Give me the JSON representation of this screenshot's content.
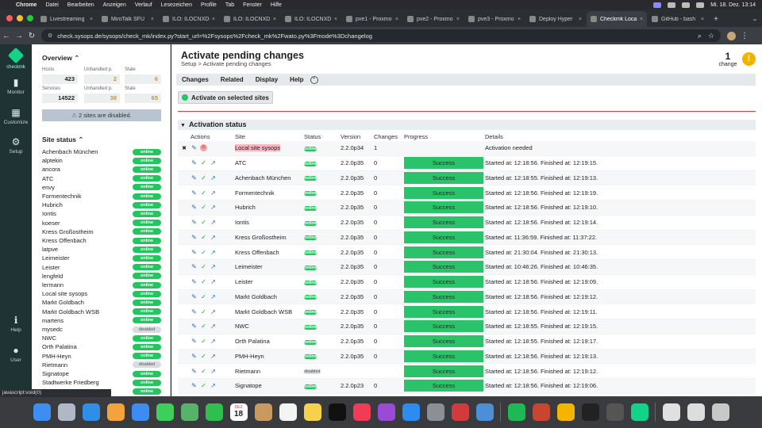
{
  "menubar": {
    "items": [
      "Chrome",
      "Datei",
      "Bearbeiten",
      "Anzeigen",
      "Verlauf",
      "Lesezeichen",
      "Profile",
      "Tab",
      "Fenster",
      "Hilfe"
    ],
    "clock": "Mi. 18. Dez. 13:14"
  },
  "browser": {
    "tabs": [
      {
        "label": "Livestreaming",
        "active": false
      },
      {
        "label": "MiroTalk SFU",
        "active": false
      },
      {
        "label": "ILO: ILOCNXDI",
        "active": false
      },
      {
        "label": "ILO: ILOCNXD",
        "active": false
      },
      {
        "label": "ILO: ILOCNXD",
        "active": false
      },
      {
        "label": "pve1 - Proxmo",
        "active": false
      },
      {
        "label": "pve2 - Proxmo",
        "active": false
      },
      {
        "label": "pve3 - Proxmo",
        "active": false
      },
      {
        "label": "Deploy Hyper",
        "active": false
      },
      {
        "label": "Checkmk Loca",
        "active": true
      },
      {
        "label": "GitHub - bash",
        "active": false
      }
    ],
    "url": "check.sysops.de/sysops/check_mk/index.py?start_url=%2Fsysops%2Fcheck_mk%2Fwato.py%3Fmode%3Dchangelog",
    "statusbar": "javascript:void(0)"
  },
  "nav": {
    "brand": "checkmk",
    "items": [
      {
        "label": "Monitor",
        "icon": "bar-chart-icon"
      },
      {
        "label": "Customize",
        "icon": "grid-icon"
      },
      {
        "label": "Setup",
        "icon": "gear-icon"
      },
      {
        "label": "Help",
        "icon": "help-icon"
      },
      {
        "label": "User",
        "icon": "user-icon"
      }
    ]
  },
  "sidebar": {
    "overview_title": "Overview",
    "overview": {
      "hosts_label": "Hosts",
      "hosts": "423",
      "hosts_unhandled_label": "Unhandled p.",
      "hosts_unhandled": "2",
      "hosts_stale_label": "Stale",
      "hosts_stale": "6",
      "services_label": "Services",
      "services": "14522",
      "services_unhandled_label": "Unhandled p.",
      "services_unhandled": "38",
      "services_stale_label": "Stale",
      "services_stale": "65"
    },
    "disabled_notice": "2 sites are disabled.",
    "site_status_title": "Site status",
    "sites": [
      {
        "name": "Achenbach München",
        "status": "online"
      },
      {
        "name": "alptekin",
        "status": "online"
      },
      {
        "name": "ancora",
        "status": "online"
      },
      {
        "name": "ATC",
        "status": "online"
      },
      {
        "name": "envy",
        "status": "online"
      },
      {
        "name": "Formentechnik",
        "status": "online"
      },
      {
        "name": "Hubrich",
        "status": "online"
      },
      {
        "name": "Iontis",
        "status": "online"
      },
      {
        "name": "koeser",
        "status": "online"
      },
      {
        "name": "Kress Großostheim",
        "status": "online"
      },
      {
        "name": "Kress Offenbach",
        "status": "online"
      },
      {
        "name": "latpve",
        "status": "online"
      },
      {
        "name": "Leimeister",
        "status": "online"
      },
      {
        "name": "Leister",
        "status": "online"
      },
      {
        "name": "lengfeld",
        "status": "online"
      },
      {
        "name": "lermann",
        "status": "online"
      },
      {
        "name": "Local site sysops",
        "status": "online"
      },
      {
        "name": "Markt Goldbach",
        "status": "online"
      },
      {
        "name": "Markt Goldbach WSB",
        "status": "online"
      },
      {
        "name": "martens",
        "status": "online"
      },
      {
        "name": "mysedc",
        "status": "disabled"
      },
      {
        "name": "NWC",
        "status": "online"
      },
      {
        "name": "Orth Palatina",
        "status": "online"
      },
      {
        "name": "PMH-Heyn",
        "status": "online"
      },
      {
        "name": "Rietmann",
        "status": "disabled"
      },
      {
        "name": "Signatope",
        "status": "online"
      },
      {
        "name": "Stadtwerke Friedberg",
        "status": "online"
      },
      {
        "name": "thermsys",
        "status": "online"
      }
    ]
  },
  "page": {
    "title": "Activate pending changes",
    "breadcrumb": "Setup > Activate pending changes",
    "change_count": "1",
    "change_label": "change",
    "menu": [
      "Changes",
      "Related",
      "Display",
      "Help"
    ],
    "activate_button": "Activate on selected sites",
    "section_title": "Activation status",
    "columns": [
      "Actions",
      "Site",
      "Status",
      "Version",
      "Changes",
      "Progress",
      "Details"
    ],
    "rows": [
      {
        "site": "Local site sysops",
        "status": "online",
        "version": "2.2.0p34",
        "changes": "1",
        "progress": "",
        "details": "Activation needed",
        "pending": true
      },
      {
        "site": "ATC",
        "status": "online",
        "version": "2.2.0p35",
        "changes": "0",
        "progress": "Success",
        "details": "Started at: 12:18:56. Finished at: 12:19:15."
      },
      {
        "site": "Achenbach München",
        "status": "online",
        "version": "2.2.0p35",
        "changes": "0",
        "progress": "Success",
        "details": "Started at: 12:18:55. Finished at: 12:19:13."
      },
      {
        "site": "Formentechnik",
        "status": "online",
        "version": "2.2.0p35",
        "changes": "0",
        "progress": "Success",
        "details": "Started at: 12:18:56. Finished at: 12:19:19."
      },
      {
        "site": "Hubrich",
        "status": "online",
        "version": "2.2.0p35",
        "changes": "0",
        "progress": "Success",
        "details": "Started at: 12:18:56. Finished at: 12:19:10."
      },
      {
        "site": "Iontis",
        "status": "online",
        "version": "2.2.0p35",
        "changes": "0",
        "progress": "Success",
        "details": "Started at: 12:18:56. Finished at: 12:19:14."
      },
      {
        "site": "Kress Großostheim",
        "status": "online",
        "version": "2.2.0p35",
        "changes": "0",
        "progress": "Success",
        "details": "Started at: 11:36:59. Finished at: 11:37:22."
      },
      {
        "site": "Kress Offenbach",
        "status": "online",
        "version": "2.2.0p35",
        "changes": "0",
        "progress": "Success",
        "details": "Started at: 21:30:04. Finished at: 21:30:13."
      },
      {
        "site": "Leimeister",
        "status": "online",
        "version": "2.2.0p35",
        "changes": "0",
        "progress": "Success",
        "details": "Started at: 10:46:26. Finished at: 10:46:35."
      },
      {
        "site": "Leister",
        "status": "online",
        "version": "2.2.0p35",
        "changes": "0",
        "progress": "Success",
        "details": "Started at: 12:18:56. Finished at: 12:19:09."
      },
      {
        "site": "Markt Goldbach",
        "status": "online",
        "version": "2.2.0p35",
        "changes": "0",
        "progress": "Success",
        "details": "Started at: 12:18:56. Finished at: 12:19:12."
      },
      {
        "site": "Markt Goldbach WSB",
        "status": "online",
        "version": "2.2.0p35",
        "changes": "0",
        "progress": "Success",
        "details": "Started at: 12:18:56. Finished at: 12:19:11."
      },
      {
        "site": "NWC",
        "status": "online",
        "version": "2.2.0p35",
        "changes": "0",
        "progress": "Success",
        "details": "Started at: 12:18:55. Finished at: 12:19:15."
      },
      {
        "site": "Orth Palatina",
        "status": "online",
        "version": "2.2.0p35",
        "changes": "0",
        "progress": "Success",
        "details": "Started at: 12:18:55. Finished at: 12:19:17."
      },
      {
        "site": "PMH-Heyn",
        "status": "online",
        "version": "2.2.0p35",
        "changes": "0",
        "progress": "Success",
        "details": "Started at: 12:18:56. Finished at: 12:19:13."
      },
      {
        "site": "Rietmann",
        "status": "disabled",
        "version": "",
        "changes": "",
        "progress": "Success",
        "details": "Started at: 12:18:56. Finished at: 12:19:12."
      },
      {
        "site": "Signatope",
        "status": "online",
        "version": "2.2.0p23",
        "changes": "0",
        "progress": "Success",
        "details": "Started at: 12:18:56. Finished at: 12:19:06."
      }
    ]
  },
  "dock": {
    "calendar_month": "DEZ",
    "calendar_day": "18"
  },
  "colors": {
    "online": "#23c55e",
    "success_bar": "#2bc36a",
    "accent": "#13d389",
    "warning": "#f0b400"
  }
}
